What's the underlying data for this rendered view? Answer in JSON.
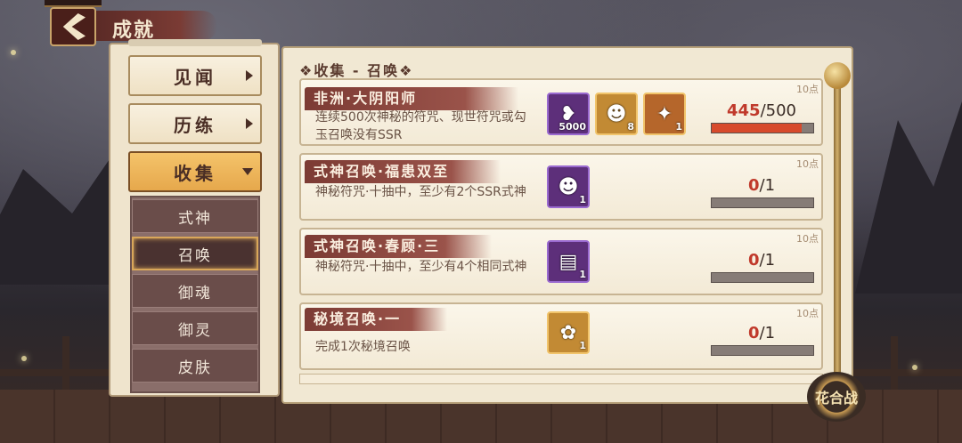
{
  "header": {
    "title": "成就"
  },
  "menu": {
    "items": [
      {
        "label": "见闻"
      },
      {
        "label": "历练"
      },
      {
        "label": "收集"
      }
    ],
    "sub_items": [
      {
        "label": "式神"
      },
      {
        "label": "召唤"
      },
      {
        "label": "御魂"
      },
      {
        "label": "御灵"
      },
      {
        "label": "皮肤"
      }
    ]
  },
  "section": {
    "title": "❖收集 - 召唤❖"
  },
  "achievements": [
    {
      "title": "非洲·大阴阳师",
      "desc": "连续500次神秘的符咒、现世符咒或勾玉召唤没有SSR",
      "points": "10点",
      "rewards": [
        {
          "icon": "red-bag-icon",
          "count": "5000"
        },
        {
          "icon": "daruma-icon",
          "count": "8"
        },
        {
          "icon": "ssr-daruma-icon",
          "count": "1"
        }
      ],
      "current": "445",
      "total": "/500",
      "progress": 0.89
    },
    {
      "title": "式神召唤·福患双至",
      "desc": "神秘符咒·十抽中，至少有2个SSR式神",
      "points": "10点",
      "rewards": [
        {
          "icon": "daruma-doll-icon",
          "count": "1"
        }
      ],
      "current": "0",
      "total": "/1",
      "progress": 0
    },
    {
      "title": "式神召唤·春顾·三",
      "desc": "神秘符咒·十抽中，至少有4个相同式神",
      "points": "10点",
      "rewards": [
        {
          "icon": "talisman-card-icon",
          "count": "1"
        }
      ],
      "current": "0",
      "total": "/1",
      "progress": 0
    },
    {
      "title": "秘境召唤·一",
      "desc": "完成1次秘境召唤",
      "points": "10点",
      "rewards": [
        {
          "icon": "character-portrait-icon",
          "count": "1"
        }
      ],
      "current": "0",
      "total": "/1",
      "progress": 0
    }
  ],
  "badge": {
    "label": "花合战"
  }
}
